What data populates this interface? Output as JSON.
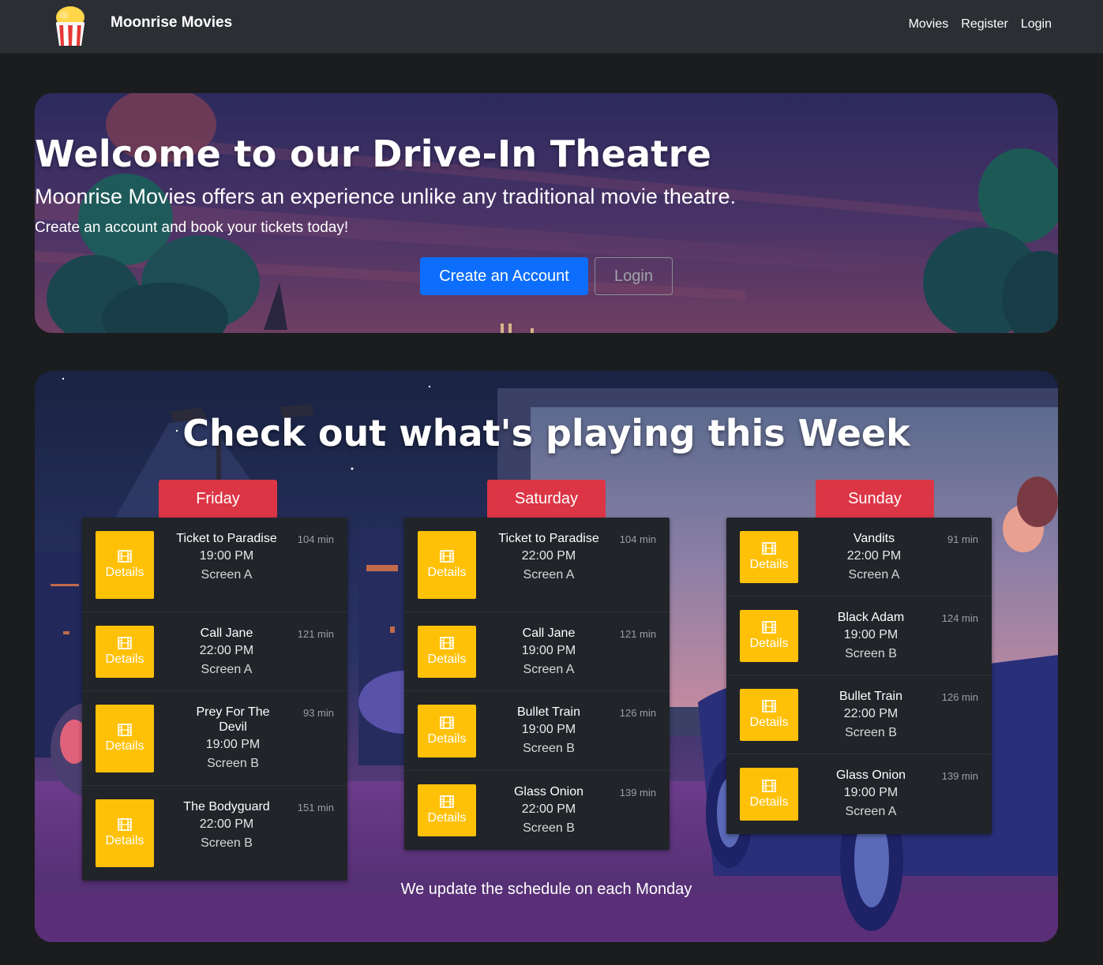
{
  "navbar": {
    "brand": "Moonrise Movies",
    "links": [
      "Movies",
      "Register",
      "Login"
    ]
  },
  "hero": {
    "title": "Welcome to our Drive-In Theatre",
    "subtitle": "Moonrise Movies offers an experience unlike any traditional movie theatre.",
    "tagline": "Create an account and book your tickets today!",
    "primary_button": "Create an Account",
    "secondary_button": "Login"
  },
  "schedule": {
    "title": "Check out what's playing this Week",
    "details_label": "Details",
    "footer": "We update the schedule on each Monday",
    "days": [
      {
        "name": "Friday",
        "movies": [
          {
            "title": "Ticket to Paradise",
            "time": "19:00 PM",
            "screen": "Screen A",
            "duration": "104 min"
          },
          {
            "title": "Call Jane",
            "time": "22:00 PM",
            "screen": "Screen A",
            "duration": "121 min"
          },
          {
            "title": "Prey For The Devil",
            "time": "19:00 PM",
            "screen": "Screen B",
            "duration": "93 min"
          },
          {
            "title": "The Bodyguard",
            "time": "22:00 PM",
            "screen": "Screen B",
            "duration": "151 min"
          }
        ]
      },
      {
        "name": "Saturday",
        "movies": [
          {
            "title": "Ticket to Paradise",
            "time": "22:00 PM",
            "screen": "Screen A",
            "duration": "104 min"
          },
          {
            "title": "Call Jane",
            "time": "19:00 PM",
            "screen": "Screen A",
            "duration": "121 min"
          },
          {
            "title": "Bullet Train",
            "time": "19:00 PM",
            "screen": "Screen B",
            "duration": "126 min"
          },
          {
            "title": "Glass Onion",
            "time": "22:00 PM",
            "screen": "Screen B",
            "duration": "139 min"
          }
        ]
      },
      {
        "name": "Sunday",
        "movies": [
          {
            "title": "Vandits",
            "time": "22:00 PM",
            "screen": "Screen A",
            "duration": "91 min"
          },
          {
            "title": "Black Adam",
            "time": "19:00 PM",
            "screen": "Screen B",
            "duration": "124 min"
          },
          {
            "title": "Bullet Train",
            "time": "22:00 PM",
            "screen": "Screen B",
            "duration": "126 min"
          },
          {
            "title": "Glass Onion",
            "time": "19:00 PM",
            "screen": "Screen A",
            "duration": "139 min"
          }
        ]
      }
    ]
  },
  "colors": {
    "navbar_bg": "#2b2e33",
    "page_bg": "#1b1c1e",
    "primary": "#0d6efd",
    "day_tab": "#dc3545",
    "details_button": "#ffc107",
    "card_bg": "#212429"
  },
  "icons": {
    "logo": "popcorn-icon",
    "details": "film-icon"
  }
}
